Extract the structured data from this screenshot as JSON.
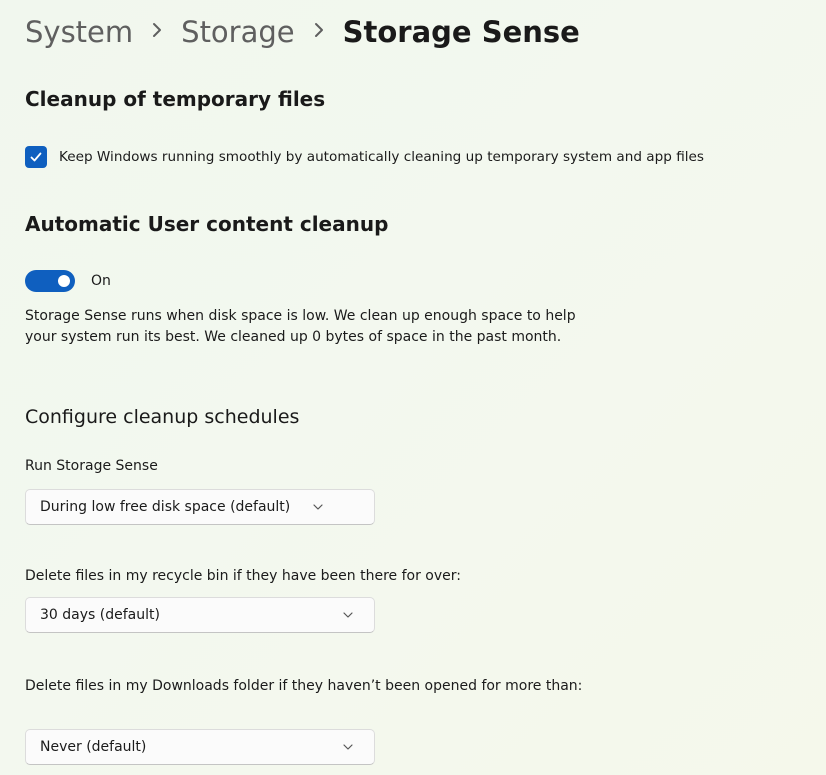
{
  "breadcrumb": {
    "items": [
      "System",
      "Storage"
    ],
    "current": "Storage Sense"
  },
  "temp_files": {
    "heading": "Cleanup of temporary files",
    "checkbox_label": "Keep Windows running smoothly by automatically cleaning up temporary system and app files",
    "checked": true
  },
  "user_content": {
    "heading": "Automatic User content cleanup",
    "toggle_label": "On",
    "toggle_on": true,
    "description": "Storage Sense runs when disk space is low. We clean up enough space to help your system run its best. We cleaned up 0 bytes of space in the past month."
  },
  "schedules": {
    "heading": "Configure cleanup schedules",
    "run_label": "Run Storage Sense",
    "run_value": "During low free disk space (default)",
    "recycle_label": "Delete files in my recycle bin if they have been there for over:",
    "recycle_value": "30 days (default)",
    "downloads_label": "Delete files in my Downloads folder if they haven’t been opened for more than:",
    "downloads_value": "Never (default)"
  },
  "colors": {
    "accent": "#0f5fbf"
  },
  "icons": {
    "separator": "chevron-right-icon",
    "dropdown": "chevron-down-icon",
    "checkbox": "checkmark-icon"
  }
}
